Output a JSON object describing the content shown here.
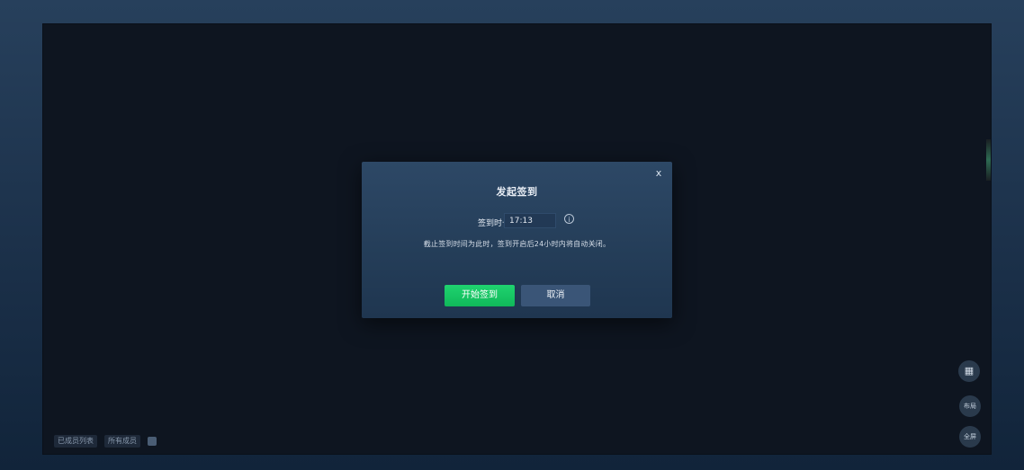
{
  "dialog": {
    "title": "发起签到",
    "close_label": "x",
    "time_label": "签到时长",
    "time_value": "17:13",
    "info_icon": "info-circle-icon",
    "hint": "截止签到时间为此时，签到开启后24小时内将自动关闭。",
    "start_button": "开始签到",
    "cancel_button": "取消"
  },
  "bottom_toolbar": {
    "items": [
      "已成员列表",
      "所有成员",
      ""
    ]
  },
  "side_buttons": {
    "grid_icon": "grid-icon",
    "button2": "布局",
    "button3": "全屏"
  },
  "colors": {
    "background": "#1b3049",
    "canvas": "#0e1520",
    "dialog": "#2b4563",
    "start_button": "#16c463",
    "cancel_button": "#3a5577"
  }
}
